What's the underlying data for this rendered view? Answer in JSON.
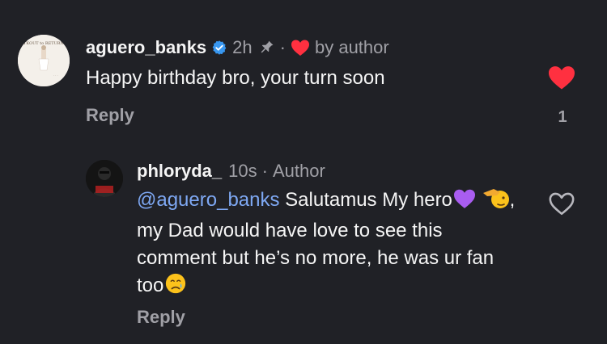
{
  "comments": [
    {
      "username": "aguero_banks",
      "time": "2h",
      "separator": "·",
      "liked_by": "by author",
      "text": "Happy birthday bro, your turn soon",
      "reply_label": "Reply",
      "like_count": "1",
      "avatar_text": "TKOUT to RETURN"
    },
    {
      "username": "phloryda_",
      "time": "10s",
      "separator": "·",
      "role": "Author",
      "mention": "@aguero_banks",
      "text_part1": " Salutamus My hero",
      "text_part2": ", my Dad would have love to see this comment but he’s no more, he was ur fan too",
      "reply_label": "Reply"
    }
  ],
  "colors": {
    "background": "#202126",
    "text": "#f5f5f5",
    "muted": "#a0a0a6",
    "mention": "#7ea8f3",
    "heart": "#ff3040",
    "verified": "#3897f0"
  }
}
